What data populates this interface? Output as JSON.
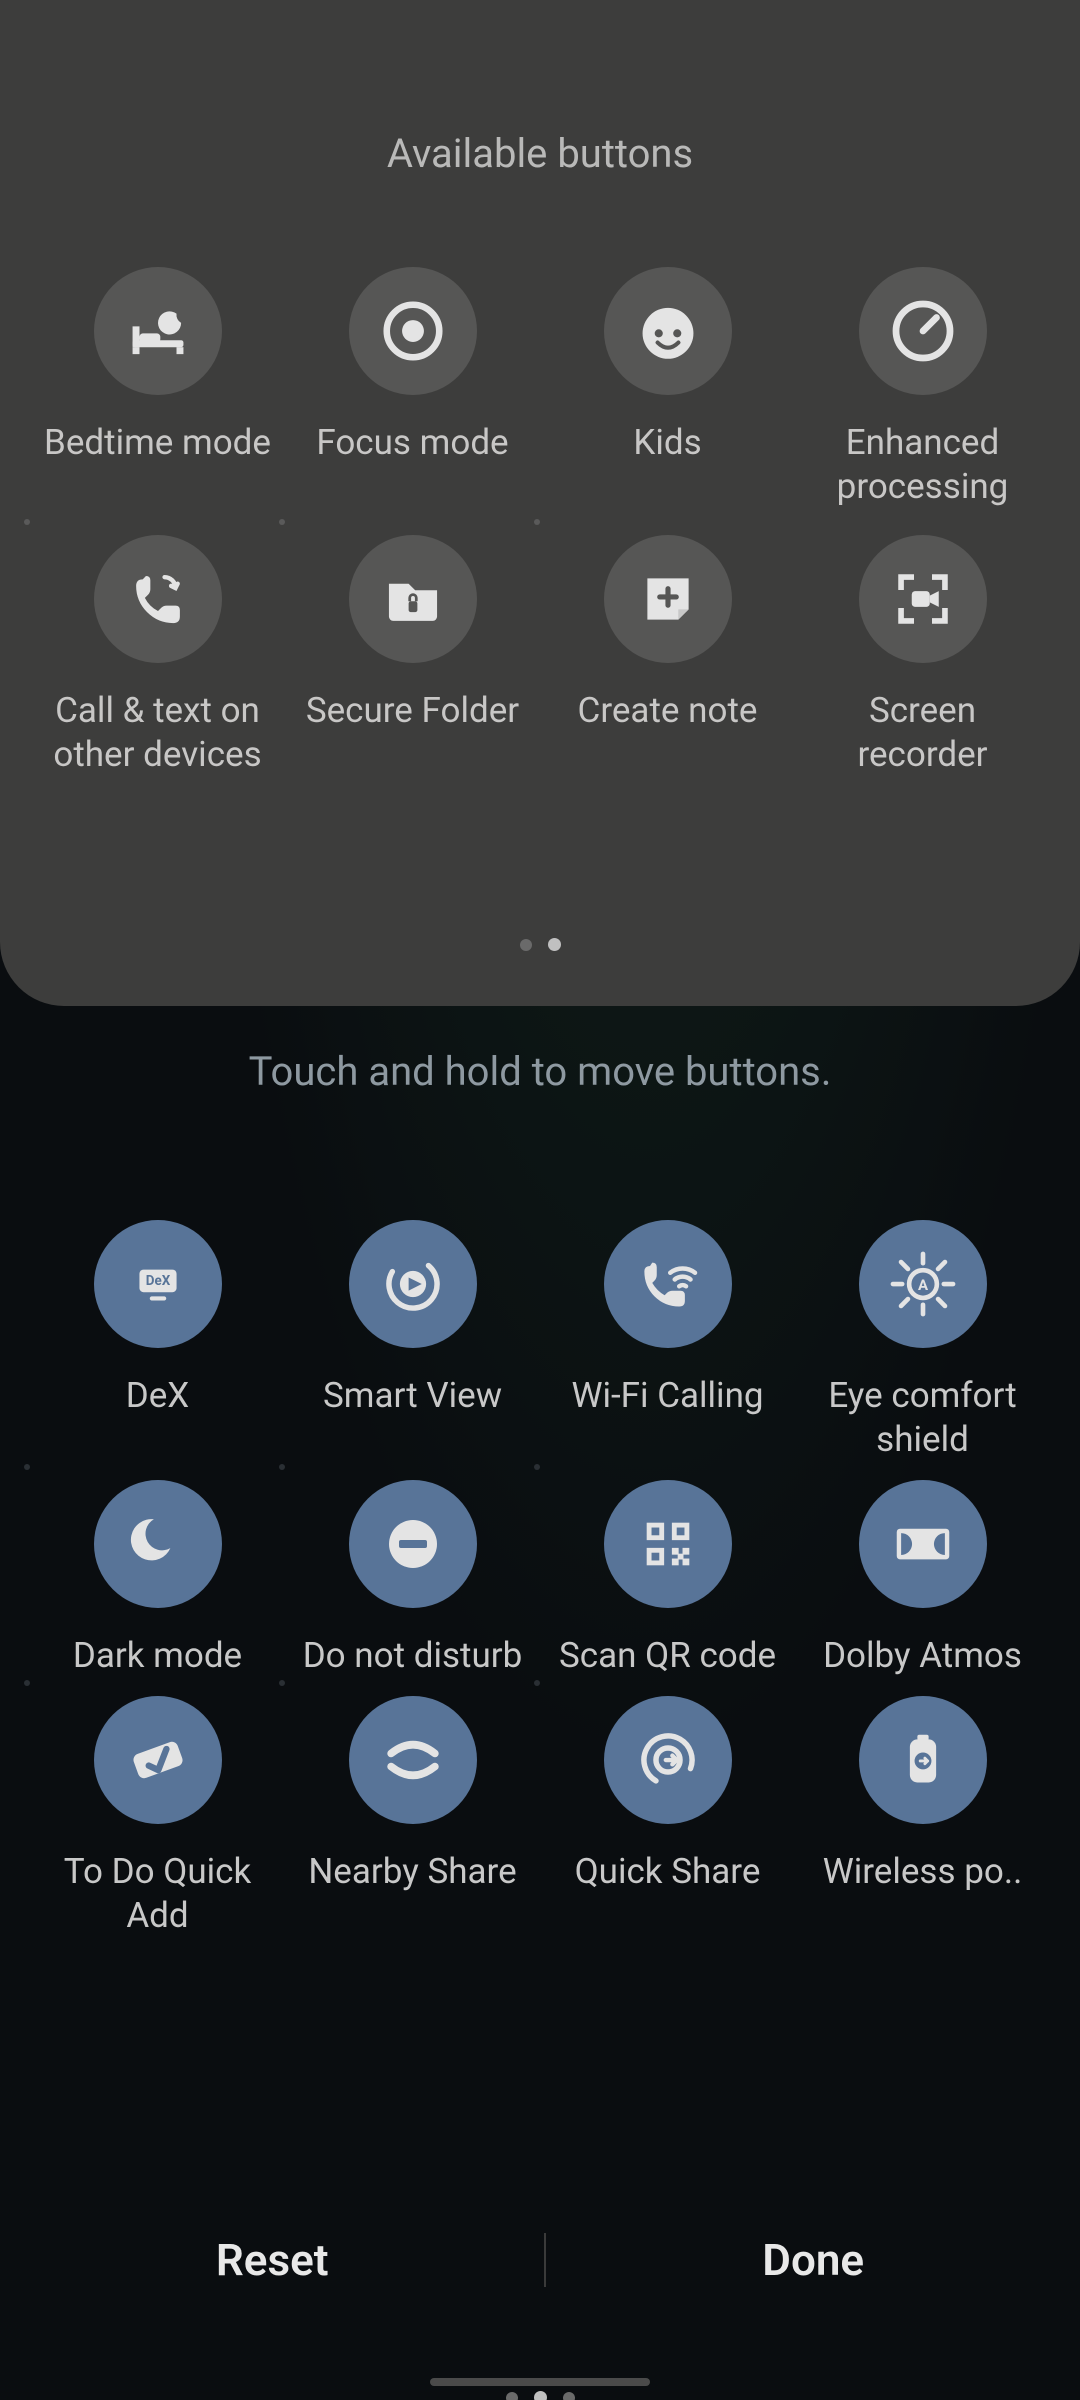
{
  "available": {
    "title": "Available buttons",
    "items": [
      {
        "key": "bedtime-mode",
        "label": "Bedtime mode",
        "icon": "bedtime-icon"
      },
      {
        "key": "focus-mode",
        "label": "Focus mode",
        "icon": "target-icon"
      },
      {
        "key": "kids",
        "label": "Kids",
        "icon": "kids-icon"
      },
      {
        "key": "enhanced-processing",
        "label": "Enhanced processing",
        "icon": "gauge-icon"
      },
      {
        "key": "call-text-other",
        "label": "Call & text on other devices",
        "icon": "call-sync-icon"
      },
      {
        "key": "secure-folder",
        "label": "Secure Folder",
        "icon": "secure-folder-icon"
      },
      {
        "key": "create-note",
        "label": "Create note",
        "icon": "create-note-icon"
      },
      {
        "key": "screen-recorder",
        "label": "Screen recorder",
        "icon": "screen-recorder-icon"
      }
    ],
    "pagination": {
      "count": 2,
      "active_index": 1
    }
  },
  "hint": "Touch and hold to move buttons.",
  "active": {
    "items": [
      {
        "key": "dex",
        "label": "DeX",
        "icon": "dex-icon"
      },
      {
        "key": "smart-view",
        "label": "Smart View",
        "icon": "smart-view-icon"
      },
      {
        "key": "wifi-calling",
        "label": "Wi-Fi Calling",
        "icon": "wifi-calling-icon"
      },
      {
        "key": "eye-comfort",
        "label": "Eye comfort shield",
        "icon": "eye-comfort-icon"
      },
      {
        "key": "dark-mode",
        "label": "Dark mode",
        "icon": "moon-icon"
      },
      {
        "key": "dnd",
        "label": "Do not disturb",
        "icon": "dnd-icon"
      },
      {
        "key": "scan-qr",
        "label": "Scan QR code",
        "icon": "qr-icon"
      },
      {
        "key": "dolby-atmos",
        "label": "Dolby Atmos",
        "icon": "dolby-icon"
      },
      {
        "key": "todo-quick-add",
        "label": "To Do Quick Add",
        "icon": "check-bar-icon"
      },
      {
        "key": "nearby-share",
        "label": "Nearby Share",
        "icon": "nearby-share-icon"
      },
      {
        "key": "quick-share",
        "label": "Quick Share",
        "icon": "quick-share-icon"
      },
      {
        "key": "wireless-power",
        "label": "Wireless po..",
        "icon": "wireless-power-icon"
      }
    ],
    "pagination": {
      "count": 3,
      "active_index": 1
    }
  },
  "footer": {
    "reset_label": "Reset",
    "done_label": "Done"
  },
  "colors": {
    "panel_bg": "#3d3d3c",
    "available_circle": "#565655",
    "active_circle": "#587498",
    "icon_fg": "#e4e4e4"
  }
}
